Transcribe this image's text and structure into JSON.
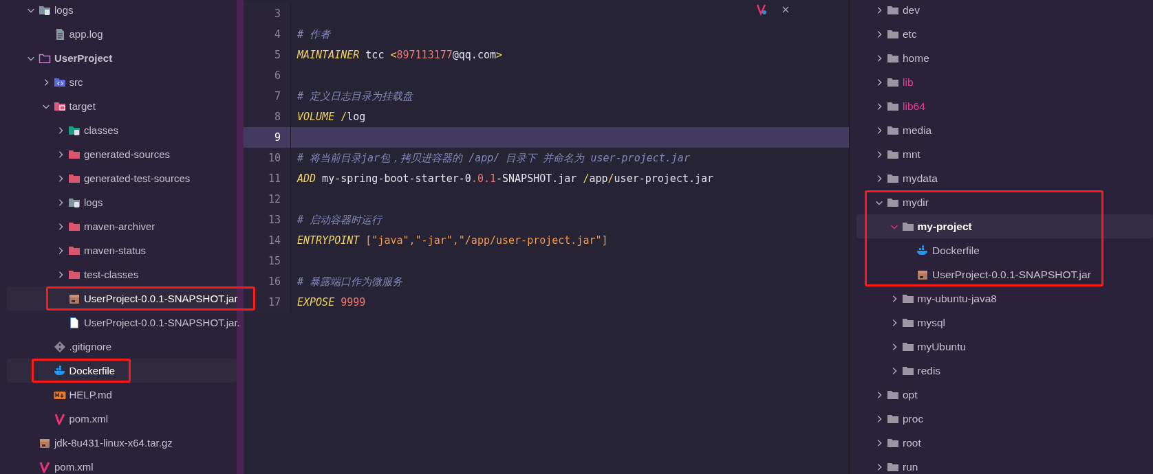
{
  "project_tree": {
    "items": [
      {
        "name": "logs",
        "kind": "folder-logs",
        "expanded": true,
        "selected": false,
        "boxed": false,
        "children": [
          {
            "name": "app.log",
            "kind": "file-text",
            "selected": false,
            "boxed": false
          }
        ]
      },
      {
        "name": "UserProject",
        "kind": "folder-project",
        "expanded": true,
        "selected": false,
        "boxed": false,
        "children": [
          {
            "name": "src",
            "kind": "folder-src",
            "expanded": false,
            "selected": false,
            "boxed": false
          },
          {
            "name": "target",
            "kind": "folder-target",
            "expanded": true,
            "selected": false,
            "boxed": false,
            "children": [
              {
                "name": "classes",
                "kind": "folder-teal",
                "expanded": false,
                "selected": false,
                "boxed": false
              },
              {
                "name": "generated-sources",
                "kind": "folder-red",
                "expanded": false,
                "selected": false,
                "boxed": false
              },
              {
                "name": "generated-test-sources",
                "kind": "folder-red",
                "expanded": false,
                "selected": false,
                "boxed": false
              },
              {
                "name": "logs",
                "kind": "folder-logs",
                "expanded": false,
                "selected": false,
                "boxed": false
              },
              {
                "name": "maven-archiver",
                "kind": "folder-red",
                "expanded": false,
                "selected": false,
                "boxed": false
              },
              {
                "name": "maven-status",
                "kind": "folder-red",
                "expanded": false,
                "selected": false,
                "boxed": false
              },
              {
                "name": "test-classes",
                "kind": "folder-red",
                "expanded": false,
                "selected": false,
                "boxed": false
              },
              {
                "name": "UserProject-0.0.1-SNAPSHOT.jar",
                "kind": "file-jar",
                "selected": true,
                "boxed": true
              },
              {
                "name": "UserProject-0.0.1-SNAPSHOT.jar.",
                "kind": "file-generic",
                "selected": false,
                "boxed": false
              }
            ]
          },
          {
            "name": ".gitignore",
            "kind": "file-git",
            "selected": false,
            "boxed": false
          },
          {
            "name": "Dockerfile",
            "kind": "file-docker",
            "selected": true,
            "boxed": true
          },
          {
            "name": "HELP.md",
            "kind": "file-md",
            "selected": false,
            "boxed": false
          },
          {
            "name": "pom.xml",
            "kind": "file-maven",
            "selected": false,
            "boxed": false
          }
        ]
      },
      {
        "name": "jdk-8u431-linux-x64.tar.gz",
        "kind": "file-jar",
        "selected": false,
        "boxed": false
      },
      {
        "name": "pom.xml",
        "kind": "file-maven",
        "selected": false,
        "boxed": false
      }
    ]
  },
  "editor": {
    "lines": [
      {
        "number": "3",
        "current": false
      },
      {
        "number": "4",
        "current": false,
        "tokens": [
          {
            "text": "# 作者",
            "kind": "comment"
          }
        ]
      },
      {
        "number": "5",
        "current": false,
        "tokens": [
          {
            "text": "MAINTAINER",
            "kind": "keyword"
          },
          {
            "text": " tcc ",
            "kind": "plain"
          },
          {
            "text": "<",
            "kind": "op"
          },
          {
            "text": "897113177",
            "kind": "number"
          },
          {
            "text": "@qq.com",
            "kind": "plain"
          },
          {
            "text": ">",
            "kind": "op"
          }
        ]
      },
      {
        "number": "6",
        "current": false
      },
      {
        "number": "7",
        "current": false,
        "tokens": [
          {
            "text": "# 定义日志目录为挂载盘",
            "kind": "comment"
          }
        ]
      },
      {
        "number": "8",
        "current": false,
        "tokens": [
          {
            "text": "VOLUME ",
            "kind": "keyword"
          },
          {
            "text": "/",
            "kind": "op"
          },
          {
            "text": "log",
            "kind": "plain"
          }
        ]
      },
      {
        "number": "9",
        "current": true
      },
      {
        "number": "10",
        "current": false,
        "tokens": [
          {
            "text": "# 将当前目录jar包，拷贝进容器的 /app/ 目录下 并命名为 user-project.jar",
            "kind": "comment"
          }
        ]
      },
      {
        "number": "11",
        "current": false,
        "tokens": [
          {
            "text": "ADD",
            "kind": "keyword"
          },
          {
            "text": " my-spring-boot-starter-0",
            "kind": "plain"
          },
          {
            "text": ".0.1",
            "kind": "number"
          },
          {
            "text": "-SNAPSHOT.jar ",
            "kind": "plain"
          },
          {
            "text": "/",
            "kind": "op"
          },
          {
            "text": "app",
            "kind": "plain"
          },
          {
            "text": "/",
            "kind": "op"
          },
          {
            "text": "user-project.jar",
            "kind": "plain"
          }
        ]
      },
      {
        "number": "12",
        "current": false
      },
      {
        "number": "13",
        "current": false,
        "tokens": [
          {
            "text": "# 启动容器时运行",
            "kind": "comment"
          }
        ]
      },
      {
        "number": "14",
        "current": false,
        "tokens": [
          {
            "text": "ENTRYPOINT ",
            "kind": "keyword"
          },
          {
            "text": "[\"java\",\"-jar\",\"/app/user-project.jar\"]",
            "kind": "string"
          }
        ]
      },
      {
        "number": "15",
        "current": false
      },
      {
        "number": "16",
        "current": false,
        "tokens": [
          {
            "text": "# 暴露端口作为微服务",
            "kind": "comment"
          }
        ]
      },
      {
        "number": "17",
        "current": false,
        "tokens": [
          {
            "text": "EXPOSE ",
            "kind": "keyword"
          },
          {
            "text": "9999",
            "kind": "number"
          }
        ]
      }
    ]
  },
  "file_tree": {
    "items": [
      {
        "name": "dev",
        "kind": "folder-gray",
        "expanded": false,
        "selected": false,
        "boxed": false,
        "symlink": false
      },
      {
        "name": "etc",
        "kind": "folder-gray",
        "expanded": false,
        "selected": false,
        "boxed": false,
        "symlink": false
      },
      {
        "name": "home",
        "kind": "folder-gray",
        "expanded": false,
        "selected": false,
        "boxed": false,
        "symlink": false
      },
      {
        "name": "lib",
        "kind": "folder-gray",
        "expanded": false,
        "selected": false,
        "boxed": false,
        "symlink": true
      },
      {
        "name": "lib64",
        "kind": "folder-gray",
        "expanded": false,
        "selected": false,
        "boxed": false,
        "symlink": true
      },
      {
        "name": "media",
        "kind": "folder-gray",
        "expanded": false,
        "selected": false,
        "boxed": false,
        "symlink": false
      },
      {
        "name": "mnt",
        "kind": "folder-gray",
        "expanded": false,
        "selected": false,
        "boxed": false,
        "symlink": false
      },
      {
        "name": "mydata",
        "kind": "folder-gray",
        "expanded": false,
        "selected": false,
        "boxed": false,
        "symlink": false
      },
      {
        "name": "mydir",
        "kind": "folder-gray",
        "expanded": true,
        "selected": false,
        "boxed": true,
        "symlink": false,
        "children": [
          {
            "name": "my-project",
            "kind": "folder-gray",
            "expanded": true,
            "selected": true,
            "boxed": true,
            "symlink": false,
            "children": [
              {
                "name": "Dockerfile",
                "kind": "file-docker",
                "selected": false,
                "boxed": true,
                "symlink": false
              },
              {
                "name": "UserProject-0.0.1-SNAPSHOT.jar",
                "kind": "file-jar",
                "selected": false,
                "boxed": true,
                "symlink": false
              }
            ]
          },
          {
            "name": "my-ubuntu-java8",
            "kind": "folder-gray",
            "expanded": false,
            "selected": false,
            "boxed": false,
            "symlink": false
          },
          {
            "name": "mysql",
            "kind": "folder-gray",
            "expanded": false,
            "selected": false,
            "boxed": false,
            "symlink": false
          },
          {
            "name": "myUbuntu",
            "kind": "folder-gray",
            "expanded": false,
            "selected": false,
            "boxed": false,
            "symlink": false
          },
          {
            "name": "redis",
            "kind": "folder-gray",
            "expanded": false,
            "selected": false,
            "boxed": false,
            "symlink": false
          }
        ]
      },
      {
        "name": "opt",
        "kind": "folder-gray",
        "expanded": false,
        "selected": false,
        "boxed": false,
        "symlink": false
      },
      {
        "name": "proc",
        "kind": "folder-gray",
        "expanded": false,
        "selected": false,
        "boxed": false,
        "symlink": false
      },
      {
        "name": "root",
        "kind": "folder-gray",
        "expanded": false,
        "selected": false,
        "boxed": false,
        "symlink": false
      },
      {
        "name": "run",
        "kind": "folder-gray",
        "expanded": false,
        "selected": false,
        "boxed": false,
        "symlink": false
      }
    ]
  }
}
